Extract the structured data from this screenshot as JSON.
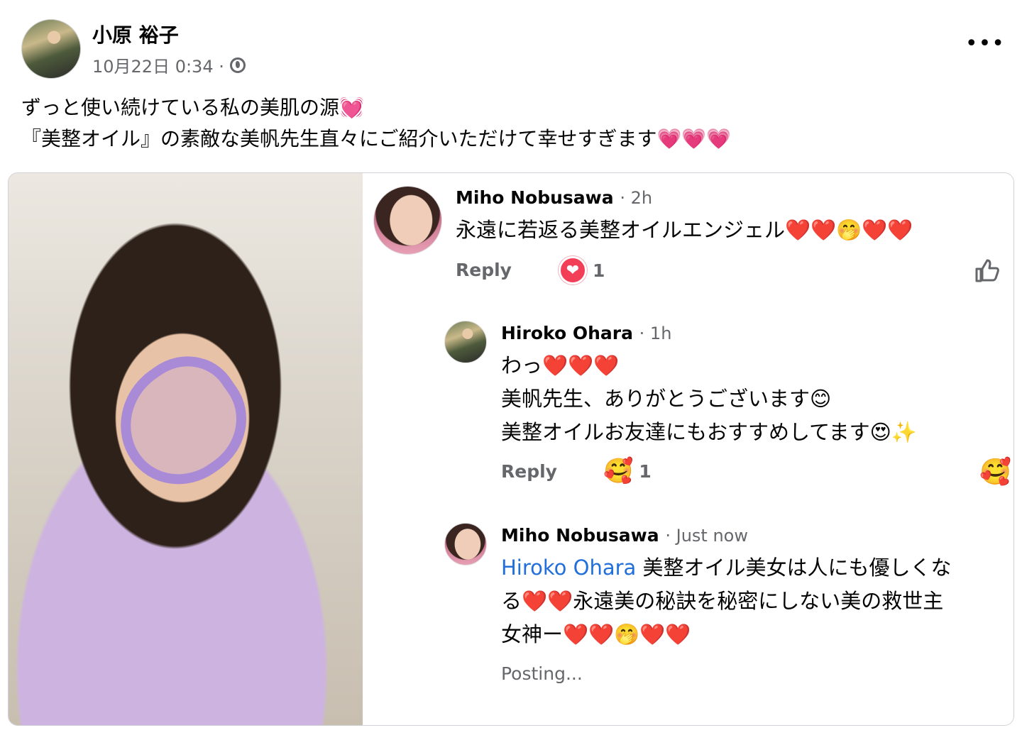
{
  "post": {
    "author": "小原 裕子",
    "date": "10月22日 0:34 ·",
    "more": "•••",
    "text_line1": "ずっと使い続けている私の美肌の源💓",
    "text_line2": "『美整オイル』の素敵な美帆先生直々にご紹介いただけて幸せすぎます💗💗💗"
  },
  "comments": [
    {
      "name": "Miho Nobusawa",
      "time": "· 2h",
      "body": "永遠に若返る美整オイルエンジェル❤️❤️🤭❤️❤️",
      "reply_label": "Reply",
      "reaction_icon": "❤",
      "reaction_count": "1"
    },
    {
      "name": "Hiroko Ohara",
      "time": "· 1h",
      "body": "わっ❤️❤️❤️\n美帆先生、ありがとうございます😊\n美整オイルお友達にもおすすめしてます😍✨",
      "reply_label": "Reply",
      "reaction_icon": "🥰",
      "reaction_count": "1",
      "right_icon": "🥰"
    },
    {
      "name": "Miho Nobusawa",
      "time": "· Just now",
      "mention": "Hiroko Ohara",
      "body": " 美整オイル美女は人にも優しくな\nる❤️❤️永遠美の秘訣を秘密にしない美の救世主\n女神ー❤️❤️🤭❤️❤️",
      "status": "Posting..."
    }
  ]
}
